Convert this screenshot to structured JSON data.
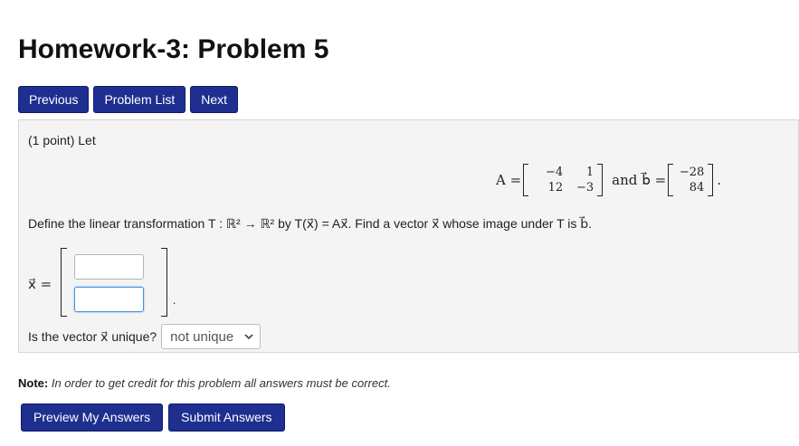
{
  "page": {
    "title": "Homework-3: Problem 5"
  },
  "nav": {
    "previous_label": "Previous",
    "problem_list_label": "Problem List",
    "next_label": "Next"
  },
  "problem": {
    "points_intro": "(1 point) Let",
    "matrix_lhs": "A =",
    "matrix_A": {
      "row1": [
        "−4",
        "1"
      ],
      "row2": [
        "12",
        "−3"
      ]
    },
    "and_text": "and",
    "vector_lhs": "b⃗ =",
    "vector_b": [
      "−28",
      "84"
    ],
    "eq_period": ".",
    "define_text": "Define the linear transformation T : ℝ² → ℝ² by T(x⃗) = Ax⃗. Find a vector x⃗ whose image under T is b⃗.",
    "x_label": "x⃗ =",
    "answer_period": ".",
    "answer_1_value": "",
    "answer_2_value": "",
    "unique_question": "Is the vector x⃗ unique?",
    "unique_selected": "not unique"
  },
  "footer": {
    "note_label": "Note:",
    "note_text": "In order to get credit for this problem all answers must be correct.",
    "preview_label": "Preview My Answers",
    "submit_label": "Submit Answers"
  },
  "colors": {
    "button_bg": "#1e2f8f",
    "problem_bg": "#f4f4f4",
    "focus_border": "#4a90d9"
  }
}
